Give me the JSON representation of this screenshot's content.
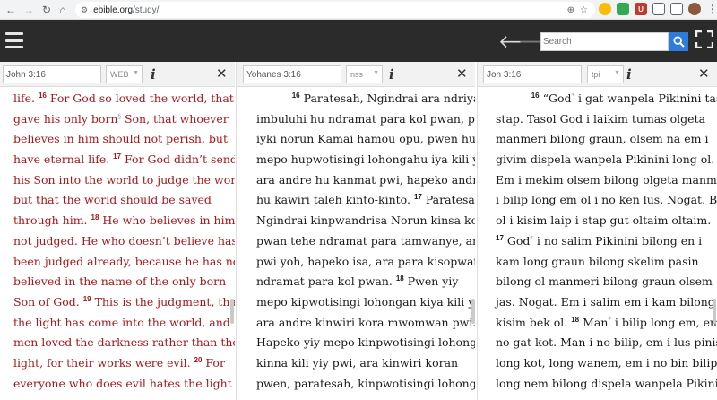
{
  "browser": {
    "url_host": "ebible.org",
    "url_path": "/study/"
  },
  "toolbar": {
    "search_placeholder": "Search"
  },
  "panes": [
    {
      "reference": "John 3:16",
      "version": "WEB",
      "color": "#a8161b",
      "lines": [
        [
          {
            "t": "life. "
          },
          {
            "v": "16"
          },
          {
            "t": " For God so loved the world, that he"
          }
        ],
        [
          {
            "t": "gave his only born"
          },
          {
            "fn": "§"
          },
          {
            "t": " Son, that whoever"
          }
        ],
        [
          {
            "t": "believes in him should not perish, but"
          }
        ],
        [
          {
            "t": "have eternal life. "
          },
          {
            "v": "17"
          },
          {
            "t": " For God didn’t send"
          }
        ],
        [
          {
            "t": "his Son into the world to judge the world,"
          }
        ],
        [
          {
            "t": "but that the world should be saved"
          }
        ],
        [
          {
            "t": "through him. "
          },
          {
            "v": "18"
          },
          {
            "t": " He who believes in him is"
          }
        ],
        [
          {
            "t": "not judged. He who doesn’t believe has"
          }
        ],
        [
          {
            "t": "been judged already, because he has not"
          }
        ],
        [
          {
            "t": "believed in the name of the only born"
          }
        ],
        [
          {
            "t": "Son of God. "
          },
          {
            "v": "19"
          },
          {
            "t": " This is the judgment, that"
          }
        ],
        [
          {
            "t": "the light has come into the world, and"
          }
        ],
        [
          {
            "t": "men loved the darkness rather than the"
          }
        ],
        [
          {
            "t": "light, for their works were evil. "
          },
          {
            "v": "20"
          },
          {
            "t": " For"
          }
        ],
        [
          {
            "t": "everyone who does evil hates the light"
          }
        ]
      ]
    },
    {
      "reference": "Yohanes 3:16",
      "version": "nss",
      "color": "#1a1a1a",
      "lines": [
        [
          {
            "t": "          "
          },
          {
            "v": "16"
          },
          {
            "t": " Paratesah, Ngindrai ara ndriyan"
          }
        ],
        [
          {
            "t": "imbuluhi hu ndramat para kol pwan, pe"
          }
        ],
        [
          {
            "t": "iyki norun Kamai hamou opu, pwen hu"
          }
        ],
        [
          {
            "t": "mepo hupwotisingi lohongahu iya kili yiy,"
          }
        ],
        [
          {
            "t": "ara andre hu kanmat pwi, hapeko andre"
          }
        ],
        [
          {
            "t": "hu kawiri taleh kinto-kinto. "
          },
          {
            "v": "17"
          },
          {
            "t": " Paratesah,"
          }
        ],
        [
          {
            "t": "Ngindrai kinpwandrisa Norun kinsa kol"
          }
        ],
        [
          {
            "t": "pwan tehe ndramat para tamwanye, ara"
          }
        ],
        [
          {
            "t": "pwi yoh, hapeko isa, ara para kisopwat hu"
          }
        ],
        [
          {
            "t": "ndramat para kol pwan. "
          },
          {
            "v": "18"
          },
          {
            "t": " Pwen yiy"
          }
        ],
        [
          {
            "t": "mepo kipwotisingi lohongan kiya kili yiy,"
          }
        ],
        [
          {
            "t": "ara andre kinwiri kora mwomwan pwi."
          }
        ],
        [
          {
            "t": "Hapeko yiy mepo kinpwotisingi lohongan"
          }
        ],
        [
          {
            "t": "kinna kili yiy pwi, ara kinwiri koran"
          }
        ],
        [
          {
            "t": "pwen, paratesah, kinpwotisingi lohongan"
          }
        ]
      ]
    },
    {
      "reference": "Jon 3:16",
      "version": "tpi",
      "color": "#1a1a1a",
      "lines": [
        [
          {
            "t": "          "
          },
          {
            "v": "16"
          },
          {
            "t": " “God"
          },
          {
            "fn": "*"
          },
          {
            "t": " i gat wanpela Pikinini tasol i"
          }
        ],
        [
          {
            "t": "stap. Tasol God i laikim tumas olgeta"
          }
        ],
        [
          {
            "t": "manmeri bilong graun, olsem na em i"
          }
        ],
        [
          {
            "t": "givim dispela wanpela Pikinini long ol."
          }
        ],
        [
          {
            "t": "Em i mekim olsem bilong olgeta manmeri"
          }
        ],
        [
          {
            "t": "i bilip long em ol i no ken lus. Nogat. Bai"
          }
        ],
        [
          {
            "t": "ol i kisim laip i stap gut oltaim oltaim."
          }
        ],
        [
          {
            "v": "17"
          },
          {
            "t": " God"
          },
          {
            "fn": "*"
          },
          {
            "t": " i no salim Pikinini bilong en i"
          }
        ],
        [
          {
            "t": "kam long graun bilong skelim pasin"
          }
        ],
        [
          {
            "t": "bilong ol manmeri bilong graun olsem"
          }
        ],
        [
          {
            "t": "jas. Nogat. Em i salim em i kam bilong"
          }
        ],
        [
          {
            "t": "kisim bek ol. "
          },
          {
            "v": "18"
          },
          {
            "t": " Man"
          },
          {
            "fn": "*"
          },
          {
            "t": " i bilip long em, em i"
          }
        ],
        [
          {
            "t": "no gat kot. Man i no bilip, em i lus pinis"
          }
        ],
        [
          {
            "t": "long kot, long wanem, em i no bin bilip"
          }
        ],
        [
          {
            "t": "long nem bilong dispela wanpela Pikinini"
          }
        ]
      ]
    }
  ]
}
